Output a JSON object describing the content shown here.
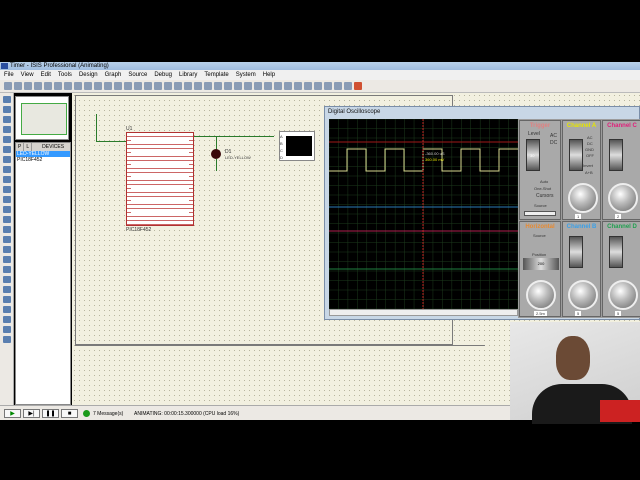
{
  "window": {
    "title": "Timer - ISIS Professional (Animating)"
  },
  "menu": [
    "File",
    "View",
    "Edit",
    "Tools",
    "Design",
    "Graph",
    "Source",
    "Debug",
    "Library",
    "Template",
    "System",
    "Help"
  ],
  "devices": {
    "tab_p": "P",
    "tab_l": "L",
    "header": "DEVICES",
    "items": [
      "LED-YELLOW",
      "PIC18F452"
    ]
  },
  "schematic": {
    "mcu_ref": "U1",
    "mcu_part": "PIC18F452",
    "led_ref": "D1",
    "led_part": "LED-YELLOW",
    "scope_pins": [
      "A",
      "B",
      "C",
      "D"
    ]
  },
  "status": {
    "messages": "7 Message(s)",
    "animating": "ANIMATING: 00:00:15.300000 (CPU load 16%)"
  },
  "scope": {
    "title": "Digital Oscilloscope",
    "cursor_time": "-360.00 uS",
    "cursor_volt": "360.00 mV",
    "trigger": {
      "title": "Trigger",
      "level": "Level",
      "ac": "AC",
      "dc": "DC",
      "auto": "Auto",
      "one_shot": "One-Shot",
      "cursors": "Cursors",
      "source": "Source",
      "sources": [
        "A",
        "B",
        "C",
        "D"
      ],
      "level_ticks": [
        "20",
        "30",
        "40"
      ]
    },
    "horizontal": {
      "title": "Horizontal",
      "source": "Source",
      "position": "Position",
      "ticks": [
        "210",
        "200",
        "190"
      ],
      "value": "2.5m"
    },
    "channels": [
      {
        "title": "Channel A",
        "color": "#e6e600",
        "ticks": [
          "90",
          "80",
          "100"
        ],
        "value": "1"
      },
      {
        "title": "Channel B",
        "color": "#3aa0e8",
        "ticks": [
          "0",
          "10",
          "20"
        ],
        "value": "5"
      },
      {
        "title": "Channel C",
        "color": "#e0207a",
        "ticks": [
          "-30",
          "-40",
          "-50"
        ],
        "value": "2"
      },
      {
        "title": "Channel D",
        "color": "#20a050",
        "ticks": [
          "-130",
          "-120",
          "-110"
        ],
        "value": "5"
      }
    ],
    "coupling": [
      "AC",
      "DC",
      "GND",
      "OFF"
    ],
    "invert": "Invert",
    "a_b": "A+B"
  }
}
